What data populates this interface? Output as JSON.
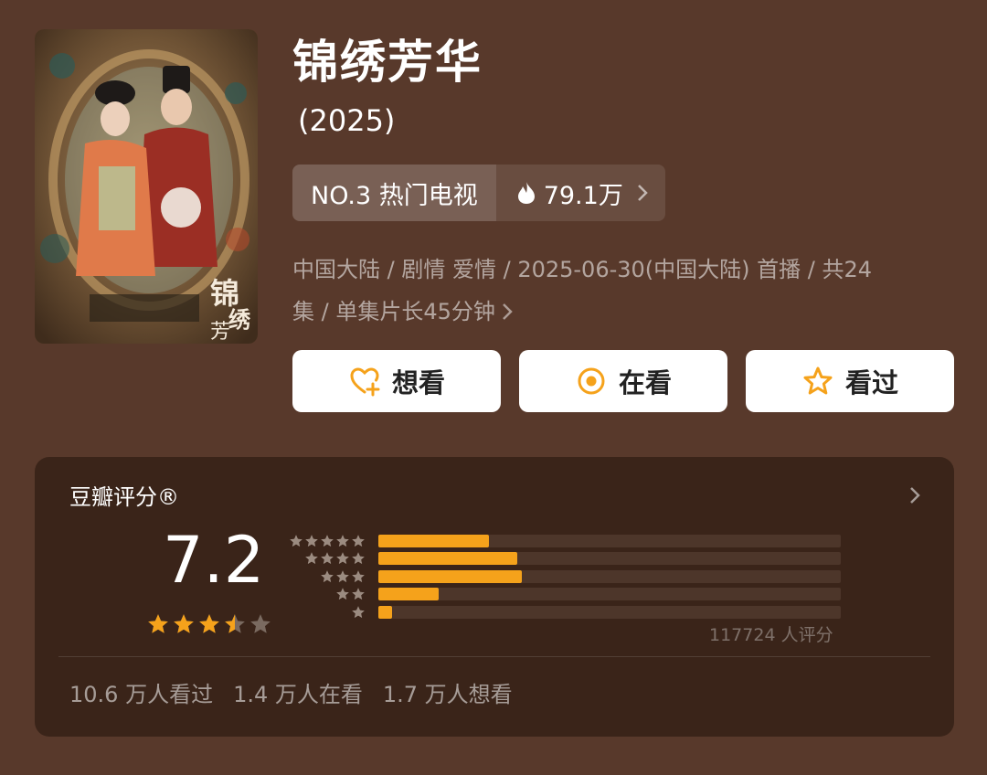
{
  "title": "锦绣芳华",
  "year": "(2025)",
  "poster_text": "锦绣芳华",
  "rank": {
    "label": "NO.3 热门电视",
    "heat": "79.1万"
  },
  "meta": {
    "line1": "中国大陆 / 剧情 爱情 / 2025-06-30(中国大陆) 首播 / 共24",
    "line2": "集 / 单集片长45分钟"
  },
  "actions": {
    "want": "想看",
    "watching": "在看",
    "watched": "看过"
  },
  "rating": {
    "title": "豆瓣评分®",
    "score": "7.2",
    "stars": 3.5,
    "count": "117724 人评分",
    "distribution": [
      {
        "stars": 5,
        "fraction": 0.24
      },
      {
        "stars": 4,
        "fraction": 0.3
      },
      {
        "stars": 3,
        "fraction": 0.31
      },
      {
        "stars": 2,
        "fraction": 0.13
      },
      {
        "stars": 1,
        "fraction": 0.03
      }
    ]
  },
  "stats": {
    "watched": "10.6 万人看过",
    "watching": "1.4 万人在看",
    "want": "1.7 万人想看"
  },
  "colors": {
    "background": "#58392b",
    "card": "#3a2419",
    "accent": "#f5a21b"
  }
}
